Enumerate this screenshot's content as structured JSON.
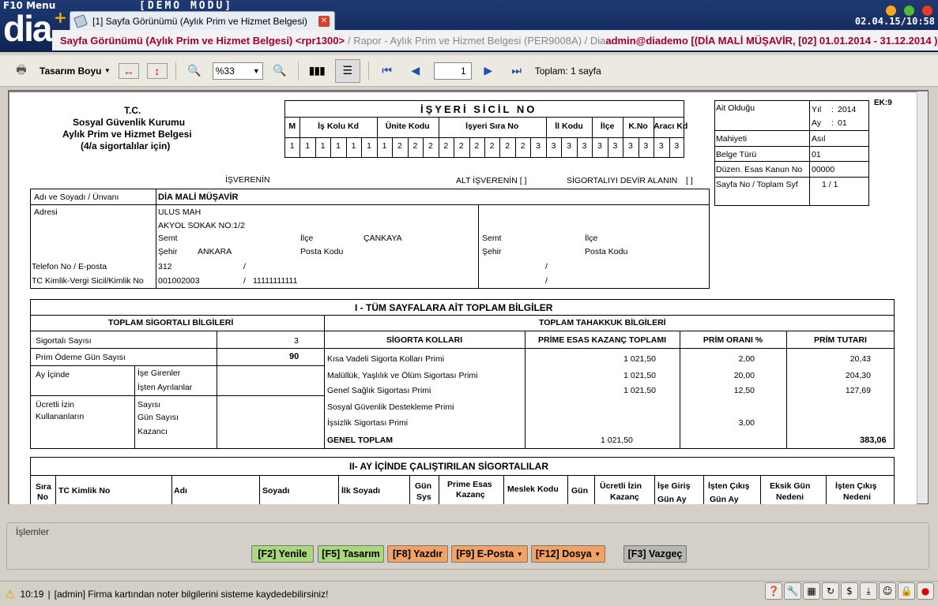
{
  "app": {
    "menu_label": "F10 Menu",
    "demo_label": "[DEMO  MODU]",
    "logo": "dia",
    "tab_title": "[1] Sayfa Görünümü (Aylık Prim ve Hizmet Belgesi)",
    "clock_date": "02.04.15/",
    "clock_time": "10:58",
    "breadcrumb_main": "Sayfa Görünümü (Aylık Prim ve Hizmet Belgesi) <rpr1300>",
    "breadcrumb_path": "/ Rapor - Aylık Prim ve Hizmet Belgesi (PER9008A) / Dia",
    "user_info": "admin@diademo [(DİA MALİ MÜŞAVİR, [02] 01.01.2014 - 31.12.2014 )]"
  },
  "toolbar": {
    "design_size_label": "Tasarım Boyu",
    "zoom_value": "%33",
    "page_value": "1",
    "total_label": "Toplam: 1 sayfa"
  },
  "report": {
    "header": {
      "tc": "T.C.",
      "sgk": "Sosyal Güvenlik Kurumu",
      "title": "Aylık Prim ve Hizmet Belgesi",
      "subtitle": "(4/a sigortalılar için)",
      "ek": "EK:9"
    },
    "sicil": {
      "title": "İŞYERİ SİCİL NO",
      "cols": [
        "M",
        "İş Kolu Kd",
        "Ünite Kodu",
        "İşyeri Sıra No",
        "İl Kodu",
        "İlçe",
        "K.No",
        "Aracı Kd"
      ],
      "digits": [
        "1",
        "1",
        "1",
        "1",
        "1",
        "1",
        "1",
        "2",
        "2",
        "2",
        "2",
        "2",
        "2",
        "2",
        "2",
        "2",
        "3",
        "3",
        "3",
        "3",
        "3",
        "3",
        "3",
        "3",
        "3",
        "3"
      ]
    },
    "info": {
      "ait_label": "Ait Olduğu",
      "yil_label": "Yıl",
      "yil_value": "2014",
      "ay_label": "Ay",
      "ay_value": "01",
      "mahiyet_label": "Mahiyeti",
      "mahiyet_value": "Asıl",
      "belge_label": "Belge Türü",
      "belge_value": "01",
      "kanun_label": "Düzen. Esas Kanun No",
      "kanun_value": "00000",
      "sayfa_label": "Sayfa No / Toplam Syf",
      "sayfa_value": "1 /  1"
    },
    "employer": {
      "isveren": "İŞVERENİN",
      "alt_isveren": "ALT İŞVERENİN [ ]",
      "devir": "SİGORTALIYI DEVİR ALANIN",
      "devir_box": "[ ]",
      "ad_label": "Adı ve Soyadı / Ünvanı",
      "ad_value": "DİA MALİ MÜŞAVİR",
      "adres_label": "Adresi",
      "adres1": "ULUS MAH",
      "adres2": "AKYOL SOKAK NO:1/2",
      "semt_label": "Semt",
      "ilce_label": "İlçe",
      "ilce_value": "ÇANKAYA",
      "sehir_label": "Şehir",
      "sehir_value": "ANKARA",
      "posta_label": "Posta Kodu",
      "telefon_label": "Telefon No  / E-posta",
      "telefon_value": "312",
      "slash": "/",
      "tc_label": "TC Kimlik-Vergi Sicil/Kimlik No",
      "tc_value": "001002003",
      "vergi_value": "11111111111"
    },
    "section1": {
      "title": "I - TÜM SAYFALARA AİT TOPLAM BİLGİLER",
      "left_title": "TOPLAM SİGORTALI BİLGİLERİ",
      "right_title": "TOPLAM TAHAKKUK BİLGİLERİ",
      "sigortali_label": "Sigortalı Sayısı",
      "sigortali_value": "3",
      "gun_label": "Prim Ödeme Gün Sayısı",
      "gun_value": "90",
      "ay_icinde": "Ay İçinde",
      "ise_girenler": "İşe Girenler",
      "isten_ayrilanlar": "İşten Ayrılanlar",
      "ucretli_izin": "Ücretli İzin",
      "kullananlarin": "Kullananların",
      "sayisi": "Sayısı",
      "gun_sayisi": "Gün Sayısı",
      "kazanc": "Kazancı",
      "col_headers": [
        "SİGORTA KOLLARI",
        "PRİME ESAS KAZANÇ TOPLAMI",
        "PRİM ORANI %",
        "PRİM TUTARI"
      ],
      "rows": [
        {
          "name": "Kısa Vadeli Sigorta Kolları Primi",
          "kazanc": "1 021,50",
          "oran": "2,00",
          "tutar": "20,43"
        },
        {
          "name": "Malüllük, Yaşlılık ve Ölüm Sigortası Primi",
          "kazanc": "1 021,50",
          "oran": "20,00",
          "tutar": "204,30"
        },
        {
          "name": "Genel Sağlık Sigortası Primi",
          "kazanc": "1 021,50",
          "oran": "12,50",
          "tutar": "127,69"
        },
        {
          "name": "Sosyal Güvenlik Destekleme Primi",
          "kazanc": "",
          "oran": "",
          "tutar": ""
        },
        {
          "name": "İşsizlik Sigortası Primi",
          "kazanc": "",
          "oran": "3,00",
          "tutar": ""
        }
      ],
      "genel_label": "GENEL TOPLAM",
      "genel_kazanc": "1 021,50",
      "genel_tutar": "383,06"
    },
    "section2": {
      "title": "II- AY İÇİNDE ÇALIŞTIRILAN SİGORTALILAR",
      "sira": "Sıra",
      "no": "No",
      "tc": "TC Kimlik No",
      "adi": "Adı",
      "soyadi": "Soyadı",
      "ilk_soyadi": "İlk Soyadı",
      "gun": "Gün",
      "sys": "Sys",
      "prime_esas": "Prime Esas",
      "kazanc": "Kazanç",
      "meslek": "Meslek Kodu",
      "gun2": "Gün",
      "ucretli_izin": "Ücretli İzin",
      "kazanc2": "Kazanç",
      "ise_giris": "İşe Giriş",
      "gun_ay1": "Gün   Ay",
      "isten_cikis": "İşten Çıkış",
      "gun_ay2": "Gün   Ay",
      "eksik_gun": "Eksik Gün",
      "nedeni1": "Nedeni",
      "isten_cikis2": "İşten Çıkış",
      "nedeni2": "Nedeni"
    }
  },
  "actions": {
    "group_label": "İşlemler",
    "yenile": "[F2] Yenile",
    "tasarim": "[F5] Tasarım",
    "yazdir": "[F8] Yazdır",
    "eposta": "[F9] E-Posta",
    "dosya": "[F12] Dosya",
    "vazgec": "[F3] Vazgeç"
  },
  "status": {
    "time": "10:19",
    "message": "[admin] Firma kartından noter bilgilerini sisteme kaydedebilirsiniz!"
  },
  "colors": {
    "titlebar": "#1f3a73",
    "breadcrumb": "#a0002a",
    "button_green": "#a8d97c",
    "button_orange": "#f3a266"
  }
}
